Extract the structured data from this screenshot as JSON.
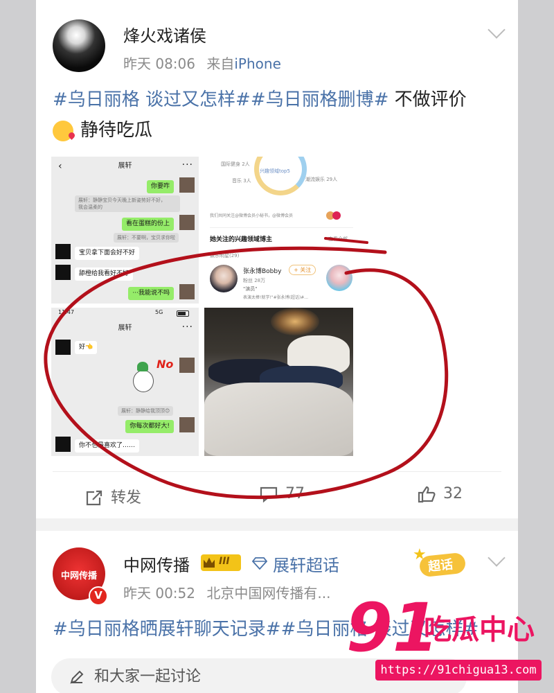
{
  "post1": {
    "username": "烽火戏诸侯",
    "time": "昨天 08:06",
    "source_prefix": "来自",
    "source": "iPhone",
    "hashtag1": "#乌日丽格 谈过又怎样#",
    "hashtag2": "#乌日丽格删博#",
    "text1": " 不做评价",
    "text2": "静待吃瓜",
    "emoji": "kissing-heart-emoji",
    "actions": {
      "repost": "转发",
      "comment_count": "77",
      "like_count": "32"
    }
  },
  "chat1": {
    "title": "展轩",
    "back": "‹",
    "more": "···",
    "msgs": [
      "你要咋",
      "看在蛋糕的份上",
      "宝贝拿下面会好不好",
      "舔橙给我看好不好",
      "···我能说不吗"
    ],
    "sys1": "展轩：静静宝贝今天晚上新姿势好不好，",
    "sys1b": "我会温柔的",
    "sys2": "展轩：不要啊，宝贝求你啦"
  },
  "chat2": {
    "time": "11:47",
    "net": "5G",
    "title": "展轩",
    "more": "···",
    "msgs": [
      "好👈",
      "你每次都好大!",
      "你不也最喜欢了……"
    ],
    "sticker_text": "No",
    "sys": "展轩：静静给我顶顶😊"
  },
  "profile": {
    "ring_label": "兴趣领域top5",
    "l1": "国际健身 2人",
    "l2": "音乐 3人",
    "r1": "潮流娱乐 29人",
    "note": "我们共同关注@微博会员小秘书，@微博会员",
    "section": "她关注的兴趣领域博主",
    "more": "查看全部",
    "sub": "娱乐明星(29)",
    "star_name": "张永博Bobby",
    "star_fans": "粉丝 28万",
    "star_tag": "\"演员\"",
    "star_desc": "表演太棒!就学!\"#张永博(超话)#...",
    "follow": "+ 关注"
  },
  "post2": {
    "username": "中网传播",
    "level": "III",
    "super_topic": "展轩超话",
    "time": "昨天 00:52",
    "source": "北京中国网传播有...",
    "avatar_text": "中网传播",
    "sticker": "超话",
    "hashtag1": "#乌日丽格晒展轩聊天记录#",
    "hashtag2": "#乌日丽格 谈过又怎样#",
    "comment_placeholder": "和大家一起讨论"
  },
  "watermark": {
    "number": "91",
    "title": "吃瓜中心",
    "url": "https://91chigua13.com"
  },
  "colors": {
    "link": "#4a72a8",
    "annotation_red": "#b3101b",
    "wechat_green": "#95ec69"
  }
}
